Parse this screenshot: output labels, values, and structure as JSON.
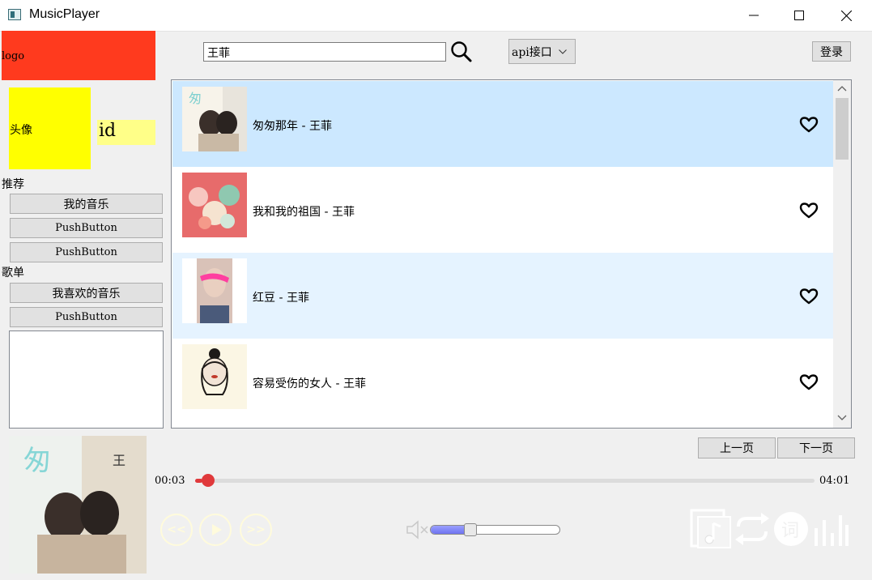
{
  "window": {
    "title": "MusicPlayer"
  },
  "sidebar": {
    "logo_text": "logo",
    "avatar_text": "头像",
    "id_text": "id",
    "recommend_label": "推荐",
    "recommend_items": [
      "我的音乐",
      "PushButton",
      "PushButton"
    ],
    "playlist_label": "歌单",
    "playlist_items": [
      "我喜欢的音乐",
      "PushButton"
    ]
  },
  "header": {
    "search_value": "王菲",
    "api_label": "api接口",
    "login_label": "登录"
  },
  "songs": [
    {
      "title": "匆匆那年 - 王菲",
      "state": "selected"
    },
    {
      "title": "我和我的祖国 - 王菲",
      "state": "normal"
    },
    {
      "title": "红豆 - 王菲",
      "state": "alternate"
    },
    {
      "title": "容易受伤的女人 - 王菲",
      "state": "normal"
    }
  ],
  "pager": {
    "prev_label": "上一页",
    "next_label": "下一页"
  },
  "player": {
    "current_time": "00:03",
    "total_time": "04:01",
    "progress": 0.012,
    "volume": 0.3,
    "prev_symbol": "<<",
    "next_symbol": ">>"
  },
  "colors": {
    "selected_row": "#cce8ff",
    "alternate_row": "#e5f3ff",
    "accent": "#e0393b",
    "logo_bg": "#ff3a1e",
    "avatar_bg": "#ffff00"
  }
}
